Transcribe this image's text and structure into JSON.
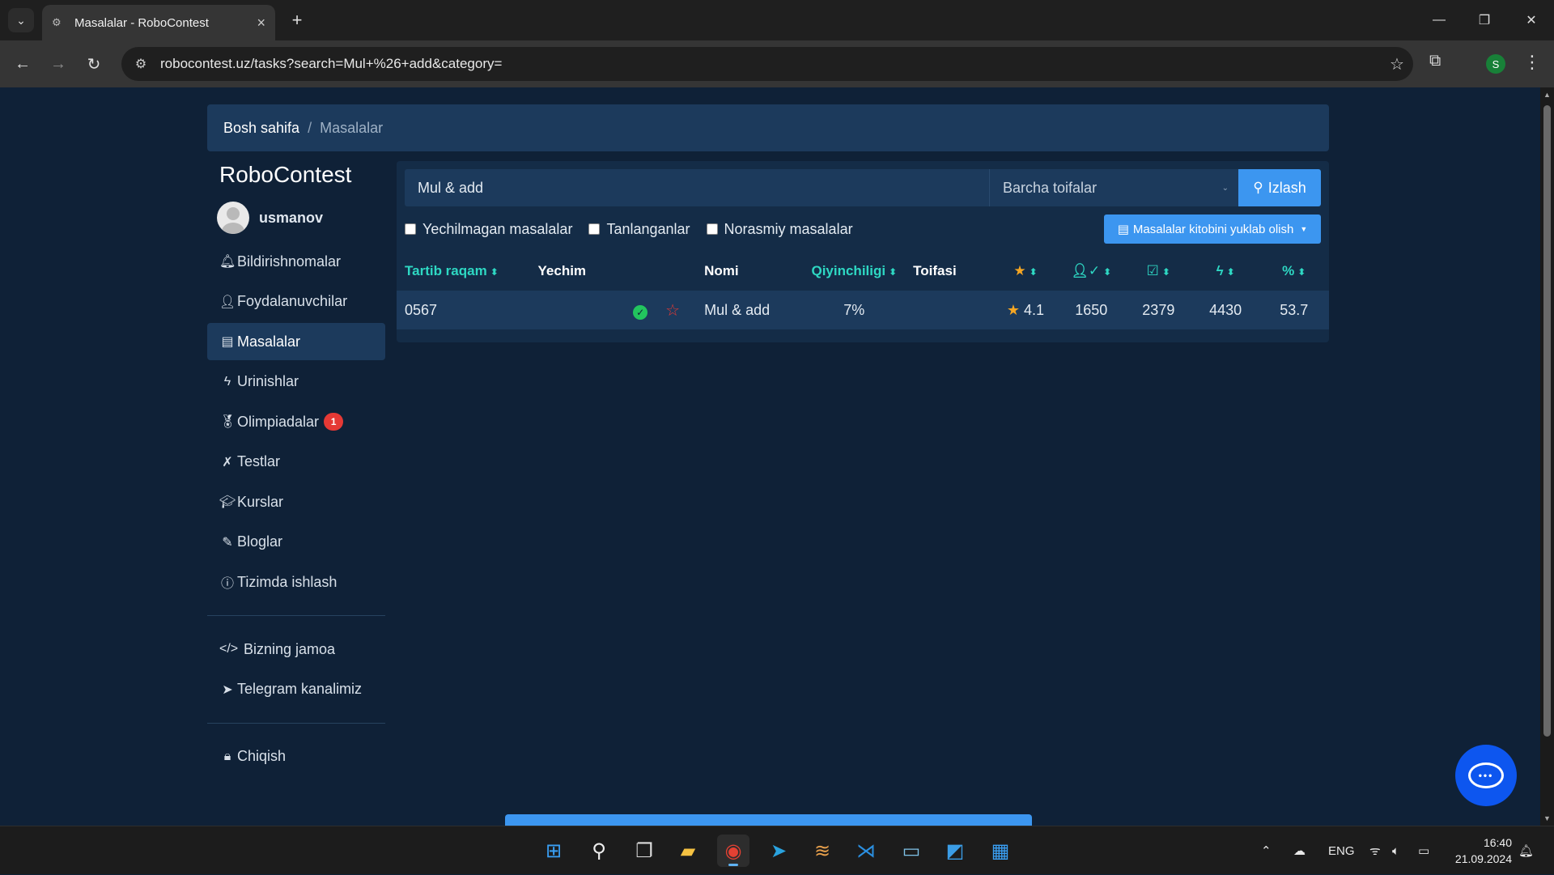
{
  "browser": {
    "tab_title": "Masalalar - RoboContest",
    "url": "robocontest.uz/tasks?search=Mul+%26+add&category=",
    "profile_initial": "S"
  },
  "breadcrumb": {
    "home": "Bosh sahifa",
    "separator": "/",
    "current": "Masalalar"
  },
  "sidebar": {
    "brand": "RoboContest",
    "username": "usmanov",
    "items": [
      {
        "label": "Bildirishnomalar",
        "icon": "bell-icon"
      },
      {
        "label": "Foydalanuvchilar",
        "icon": "user-icon"
      },
      {
        "label": "Masalalar",
        "icon": "book-icon",
        "active": true
      },
      {
        "label": "Urinishlar",
        "icon": "activity-icon"
      },
      {
        "label": "Olimpiadalar",
        "icon": "medal-icon",
        "badge": "1"
      },
      {
        "label": "Testlar",
        "icon": "tools-icon"
      },
      {
        "label": "Kurslar",
        "icon": "graduation-cap-icon"
      },
      {
        "label": "Bloglar",
        "icon": "pencil-icon"
      },
      {
        "label": "Tizimda ishlash",
        "icon": "info-icon"
      }
    ],
    "secondary": [
      {
        "label": "Bizning jamoa",
        "icon": "code-icon"
      },
      {
        "label": "Telegram kanalimiz",
        "icon": "telegram-icon"
      }
    ],
    "logout": {
      "label": "Chiqish",
      "icon": "lock-icon"
    }
  },
  "search": {
    "value": "Mul & add",
    "category": "Barcha toifalar",
    "button": "Izlash"
  },
  "filters": {
    "unsolved": "Yechilmagan masalalar",
    "favorites": "Tanlanganlar",
    "unofficial": "Norasmiy masalalar",
    "download": "Masalalar kitobini yuklab olish"
  },
  "table": {
    "headers": {
      "id": "Tartib raqam",
      "solution": "Yechim",
      "name": "Nomi",
      "difficulty": "Qiyinchiligi",
      "category": "Toifasi"
    },
    "rows": [
      {
        "id": "0567",
        "name": "Mul & add",
        "difficulty": "7%",
        "category": "",
        "rating": "4.1",
        "solvers": "1650",
        "accepted": "2379",
        "attempts": "4430",
        "percent": "53.7"
      }
    ]
  },
  "taskbar": {
    "language": "ENG",
    "time": "16:40",
    "date": "21.09.2024"
  },
  "colors": {
    "page_bg": "#0f2137",
    "panel_bg": "#1c3a5c",
    "accent_teal": "#2ed8c3",
    "primary_blue": "#3c96f0",
    "chat_blue": "#0d56ef"
  }
}
